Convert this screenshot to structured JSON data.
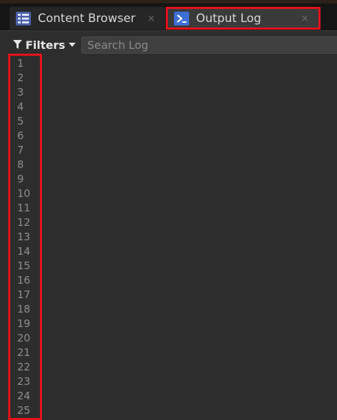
{
  "tabs": [
    {
      "label": "Content Browser",
      "icon": "content-browser-icon",
      "close": "×",
      "active": false
    },
    {
      "label": "Output Log",
      "icon": "output-log-icon",
      "close": "×",
      "active": true
    }
  ],
  "toolbar": {
    "filters_label": "Filters",
    "search_placeholder": "Search Log",
    "search_value": ""
  },
  "log": {
    "line_numbers": [
      "1",
      "2",
      "3",
      "4",
      "5",
      "6",
      "7",
      "8",
      "9",
      "10",
      "11",
      "12",
      "13",
      "14",
      "15",
      "16",
      "17",
      "18",
      "19",
      "20",
      "21",
      "22",
      "23",
      "24",
      "25"
    ]
  },
  "colors": {
    "highlight": "#e8111b",
    "panel_bg": "#2d2d2d",
    "tab_bar_bg": "#151515"
  }
}
